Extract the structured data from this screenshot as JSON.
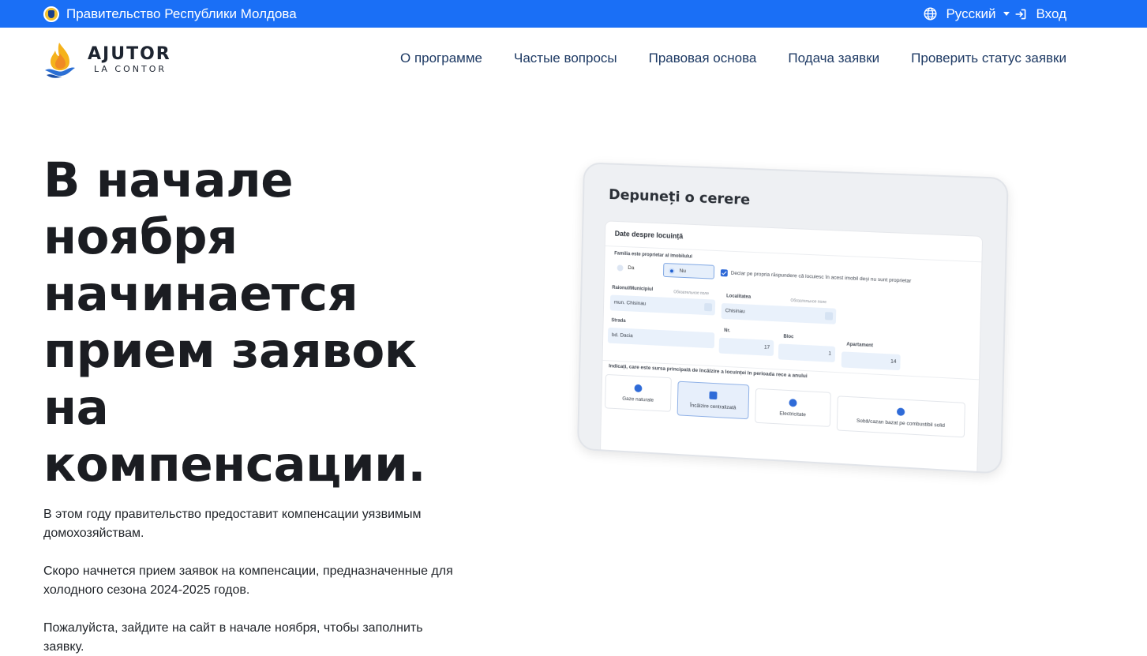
{
  "gov_bar": {
    "title": "Правительство Республики Молдова",
    "language": "Русский",
    "login": "Вход"
  },
  "logo": {
    "title": "AJUTOR",
    "subtitle": "LA CONTOR"
  },
  "nav": [
    {
      "label": "О программе"
    },
    {
      "label": "Частые вопросы"
    },
    {
      "label": "Правовая основа"
    },
    {
      "label": "Подача заявки"
    },
    {
      "label": "Проверить статус заявки"
    }
  ],
  "hero": {
    "title": "В начале ноября начинается прием заявок на компенсации.",
    "paragraphs": [
      "В этом году правительство предоставит компенсации уязвимым домохозяйствам.",
      "Скоро начнется прием заявок на компенсации, предназначенные для холодного сезона 2024-2025 годов.",
      "Пожалуйста, зайдите на сайт в начале ноября, чтобы заполнить заявку."
    ]
  },
  "mockup": {
    "title": "Depuneți o cerere",
    "section": "Date despre locuință",
    "owner_question": "Familia este proprietar al imobilului",
    "opt_yes": "Da",
    "opt_no": "Nu",
    "declaration": "Declar pe propria răspundere că locuiesc în acest imobil deși nu sunt proprietar",
    "raion_label": "Raionul/Municipiul",
    "required": "Обязательное поле",
    "raion_value": "mun. Chisinau",
    "locality_label": "Localitatea",
    "locality_value": "Chisinau",
    "street_label": "Strada",
    "street_value": "bd. Dacia",
    "nr_label": "Nr.",
    "nr_value": "17",
    "block_label": "Bloc",
    "block_value": "1",
    "apt_label": "Apartament",
    "apt_value": "14",
    "heating_question": "Indicați, care este sursa principală de încălzire a locuinței în perioada rece a anului",
    "heating_options": [
      "Gaze naturale",
      "Încălzire centralizată",
      "Electricitate",
      "Sobă/cazan bazat pe combustibil solid"
    ],
    "selected_heating": "Încălzire centralizată"
  },
  "colors": {
    "gov_bar": "#1a6ff6",
    "nav_text": "#1e3a64",
    "title_text": "#1b1d22",
    "accent": "#2f6bd8"
  }
}
